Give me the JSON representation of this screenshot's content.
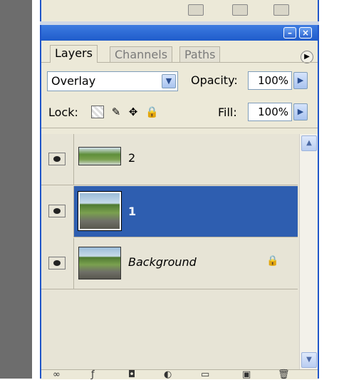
{
  "tabs": [
    {
      "label": "Layers",
      "active": true
    },
    {
      "label": "Channels",
      "active": false
    },
    {
      "label": "Paths",
      "active": false
    }
  ],
  "blend_mode": "Overlay",
  "opacity": {
    "label": "Opacity:",
    "value": "100%"
  },
  "lock": {
    "label": "Lock:",
    "icons": [
      "lock-transparent-icon",
      "lock-image-brush-icon",
      "lock-position-move-icon",
      "lock-all-icon"
    ]
  },
  "fill": {
    "label": "Fill:",
    "value": "100%"
  },
  "layers": [
    {
      "name": "2",
      "selected": false,
      "visible": true,
      "locked": false
    },
    {
      "name": "1",
      "selected": true,
      "visible": true,
      "locked": false
    },
    {
      "name": "Background",
      "selected": false,
      "visible": true,
      "locked": true
    }
  ],
  "titlebar_buttons": [
    "minimize",
    "close"
  ],
  "bottom_icons": [
    "link-layers-icon",
    "layer-style-icon",
    "layer-mask-icon",
    "adjustment-layer-icon",
    "new-group-icon",
    "new-layer-icon",
    "delete-layer-icon"
  ],
  "colors": {
    "selection": "#2e5eb0",
    "titlebar": "#2a6ad8",
    "panel": "#ece9d8"
  }
}
